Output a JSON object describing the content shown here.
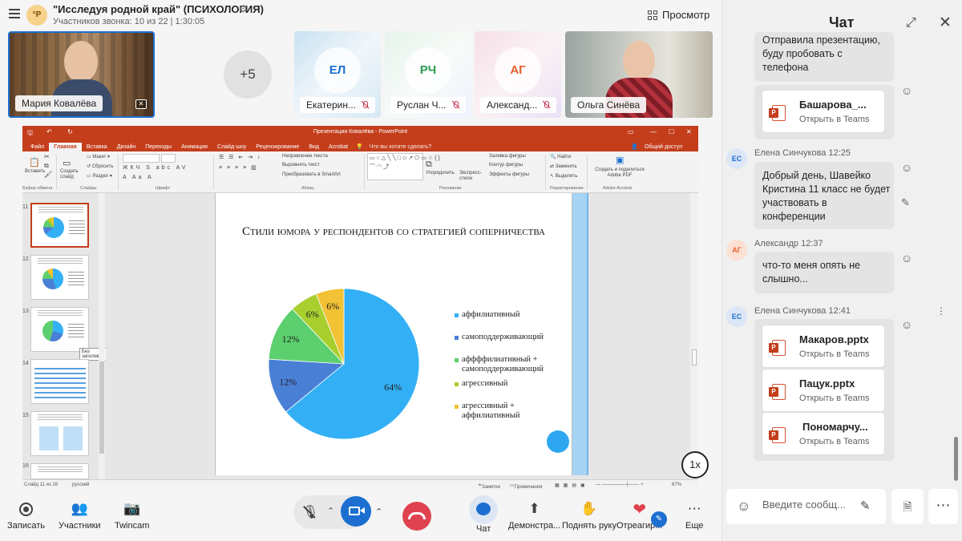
{
  "header": {
    "room_avatar": "°Р",
    "title": "\"Исследуя родной край\" (ПСИХОЛОГИЯ)",
    "subtitle": "Участников звонка: 10 из 22 | 1:30:05",
    "view_label": "Просмотр"
  },
  "participants": [
    {
      "name": "Мария Ковалёва",
      "initials": "",
      "video": true
    },
    {
      "name": "Екатерин...",
      "initials": "ЕЛ",
      "color": "#1c6fd1",
      "video": false
    },
    {
      "name": "Руслан Ч...",
      "initials": "РЧ",
      "color": "#2a9d4f",
      "video": false
    },
    {
      "name": "Александ...",
      "initials": "АГ",
      "color": "#e3602b",
      "video": false
    },
    {
      "name": "Ольга Синёва",
      "initials": "",
      "video": true
    }
  ],
  "more_count": "+5",
  "ppt": {
    "window_title": "Презентация Ковалёва - PowerPoint",
    "tabs": [
      "Файл",
      "Главная",
      "Вставка",
      "Дизайн",
      "Переходы",
      "Анимация",
      "Слайд-шоу",
      "Рецензирование",
      "Вид",
      "Acrobat"
    ],
    "active_tab": "Главная",
    "tell_me": "Что вы хотите сделать?",
    "share": "Общий доступ",
    "ribbon": {
      "paste": "Вставить",
      "create_slide": "Создать слайд",
      "layout": "Макет",
      "reset": "Сбросить",
      "section": "Раздел",
      "text_direction": "Направление текста",
      "align_text": "Выровнять текст",
      "smartart": "Преобразовать в SmartArt",
      "arrange": "Упорядочить",
      "quick_styles": "Экспресс-стили",
      "fill": "Заливка фигуры",
      "outline": "Контур фигуры",
      "effects": "Эффекты фигуры",
      "find": "Найти",
      "replace": "Заменить",
      "select": "Выделить",
      "adobe": "Создать и поделиться Adobe PDF",
      "groups": [
        "Буфер обмена",
        "Слайды",
        "Шрифт",
        "Абзац",
        "Рисование",
        "Редактирование",
        "Adobe Acrobat"
      ]
    },
    "thumbnails": [
      {
        "num": "11",
        "selected": true
      },
      {
        "num": "12",
        "selected": false
      },
      {
        "num": "13",
        "selected": false
      },
      {
        "num": "14",
        "selected": false
      },
      {
        "num": "15",
        "selected": false
      },
      {
        "num": "16",
        "selected": false
      }
    ],
    "tooltip": "Без заголовка",
    "status": {
      "slide": "Слайд 11 из 16",
      "lang": "русский",
      "notes": "Заметки",
      "comments": "Примечания",
      "zoom": "67%"
    }
  },
  "speed": "1x",
  "chart_data": {
    "type": "pie",
    "title": "Стили юмора у респондентов со стратегией соперничества",
    "categories": [
      "аффилиативный",
      "самоподдерживающий",
      "аффффилиативный + самоподдерживающий",
      "агрессивный",
      "агрессивный + аффилиативный"
    ],
    "values": [
      64,
      12,
      12,
      6,
      6
    ],
    "labels": [
      "64%",
      "12%",
      "12%",
      "6%",
      "6%"
    ],
    "colors": [
      "#33b0f5",
      "#4a7fd6",
      "#5ccf6e",
      "#a9cf2f",
      "#f2c234"
    ],
    "legend_position": "right"
  },
  "toolbar": {
    "record": "Записать",
    "participants": "Участники",
    "twincam": "Twincam",
    "chat": "Чат",
    "share": "Демонстра...",
    "raise_hand": "Поднять руку",
    "react": "Отреагир...",
    "more": "Еще"
  },
  "chat": {
    "title": "Чат",
    "messages": [
      {
        "type": "text",
        "text": "Отправила презентацию, буду пробовать с телефона"
      },
      {
        "type": "file",
        "name": "Башарова_...",
        "open": "Открыть в Teams"
      },
      {
        "sender": "Елена Синчукова",
        "initials": "ЕС",
        "time": "12:25",
        "type": "text",
        "text": "Добрый день, Шавейко Кристина 11 класс не будет участвовать в конференции"
      },
      {
        "sender": "Александр",
        "initials": "АГ",
        "time": "12:37",
        "type": "text",
        "text": "что-то меня опять не слышно..."
      },
      {
        "sender": "Елена Синчукова",
        "initials": "ЕС",
        "time": "12:41",
        "type": "files",
        "files": [
          {
            "name": "Макаров.pptx",
            "open": "Открыть в Teams"
          },
          {
            "name": "Пацук.pptx",
            "open": "Открыть в Teams"
          },
          {
            "name": "Пономарчу...",
            "open": "Открыть в Teams"
          }
        ]
      }
    ],
    "compose_placeholder": "Введите сообщ..."
  }
}
